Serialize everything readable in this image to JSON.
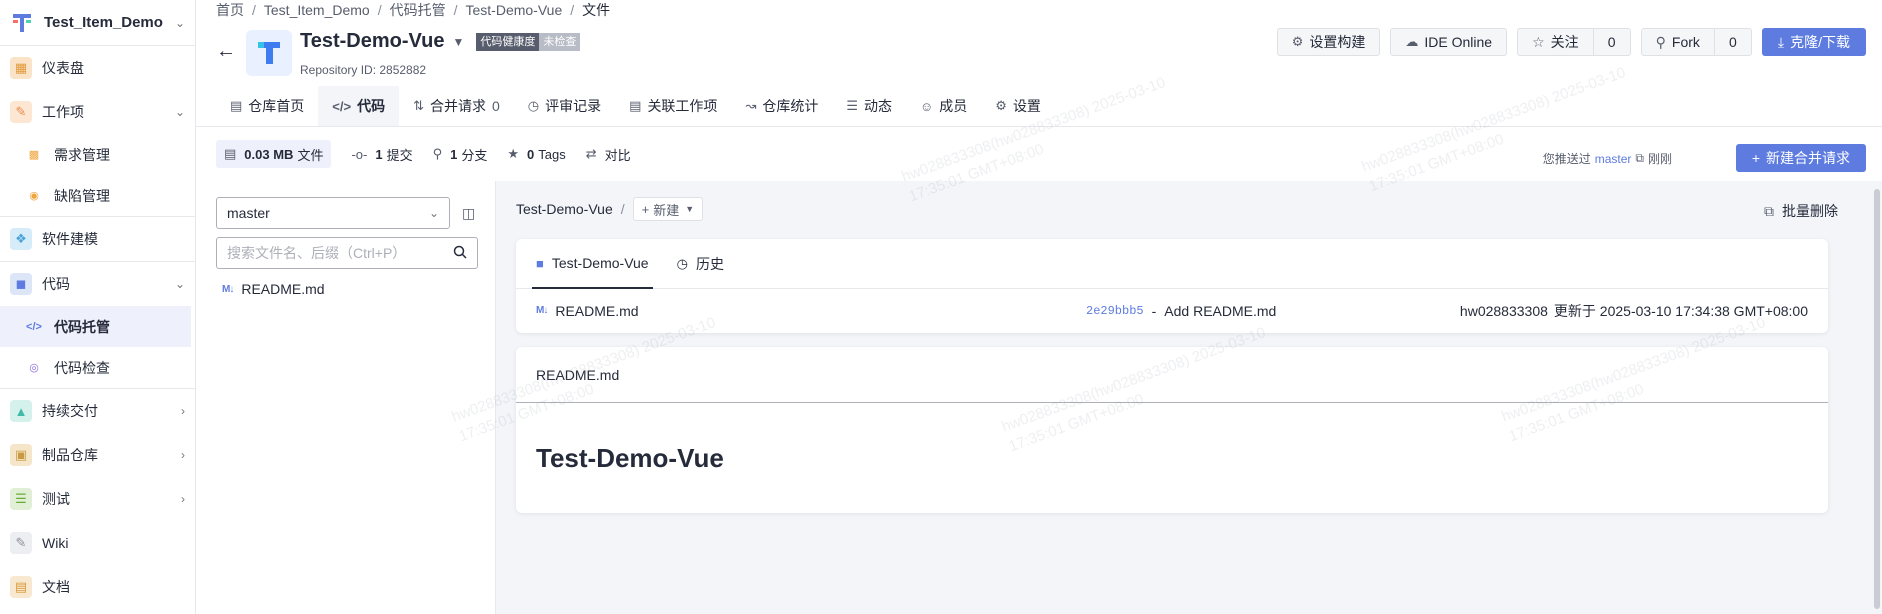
{
  "sidebar": {
    "project_name": "Test_Item_Demo",
    "items": [
      {
        "label": "仪表盘"
      },
      {
        "label": "工作项"
      },
      {
        "label": "需求管理"
      },
      {
        "label": "缺陷管理"
      },
      {
        "label": "软件建模"
      },
      {
        "label": "代码"
      },
      {
        "label": "代码托管"
      },
      {
        "label": "代码检查"
      },
      {
        "label": "持续交付"
      },
      {
        "label": "制品仓库"
      },
      {
        "label": "测试"
      },
      {
        "label": "Wiki"
      },
      {
        "label": "文档"
      }
    ]
  },
  "breadcrumb": [
    "首页",
    "Test_Item_Demo",
    "代码托管",
    "Test-Demo-Vue",
    "文件"
  ],
  "repo": {
    "name": "Test-Demo-Vue",
    "health_label": "代码健康度",
    "health_status": "未检查",
    "repository_id": "Repository ID: 2852882"
  },
  "actions": {
    "settings_build": "设置构建",
    "ide_online": "IDE Online",
    "watch": "关注",
    "watch_count": "0",
    "fork": "Fork",
    "fork_count": "0",
    "clone": "克隆/下载"
  },
  "tabs": [
    {
      "label": "仓库首页",
      "count": ""
    },
    {
      "label": "代码",
      "count": ""
    },
    {
      "label": "合并请求",
      "count": "0"
    },
    {
      "label": "评审记录",
      "count": ""
    },
    {
      "label": "关联工作项",
      "count": ""
    },
    {
      "label": "仓库统计",
      "count": ""
    },
    {
      "label": "动态",
      "count": ""
    },
    {
      "label": "成员",
      "count": ""
    },
    {
      "label": "设置",
      "count": ""
    }
  ],
  "stats": {
    "size": "0.03 MB",
    "size_label": "文件",
    "commits": "1",
    "commits_label": "提交",
    "branches": "1",
    "branches_label": "分支",
    "tags": "0",
    "tags_label": "Tags",
    "compare": "对比"
  },
  "pushed": {
    "prefix": "您推送过",
    "branch": "master",
    "time": "刚刚"
  },
  "new_mr": "新建合并请求",
  "file_panel": {
    "branch": "master",
    "search_placeholder": "搜索文件名、后缀（Ctrl+P）",
    "files": [
      "README.md"
    ]
  },
  "content": {
    "path_root": "Test-Demo-Vue",
    "new_label": "新建",
    "bulk_delete": "批量删除",
    "card_tab_files": "Test-Demo-Vue",
    "card_tab_history": "历史",
    "row": {
      "file": "README.md",
      "hash": "2e29bbb5",
      "message": "Add README.md",
      "author": "hw028833308",
      "updated": "更新于 2025-03-10 17:34:38 GMT+08:00"
    },
    "readme_title": "README.md",
    "readme_heading": "Test-Demo-Vue"
  },
  "watermark": "hw028833308(hw028833308) 2025-03-10 17:35:01 GMT+08:00",
  "colors": {
    "primary": "#5e7ce0",
    "active_bg": "#eef0fb",
    "page_bg": "#f3f5f9"
  }
}
